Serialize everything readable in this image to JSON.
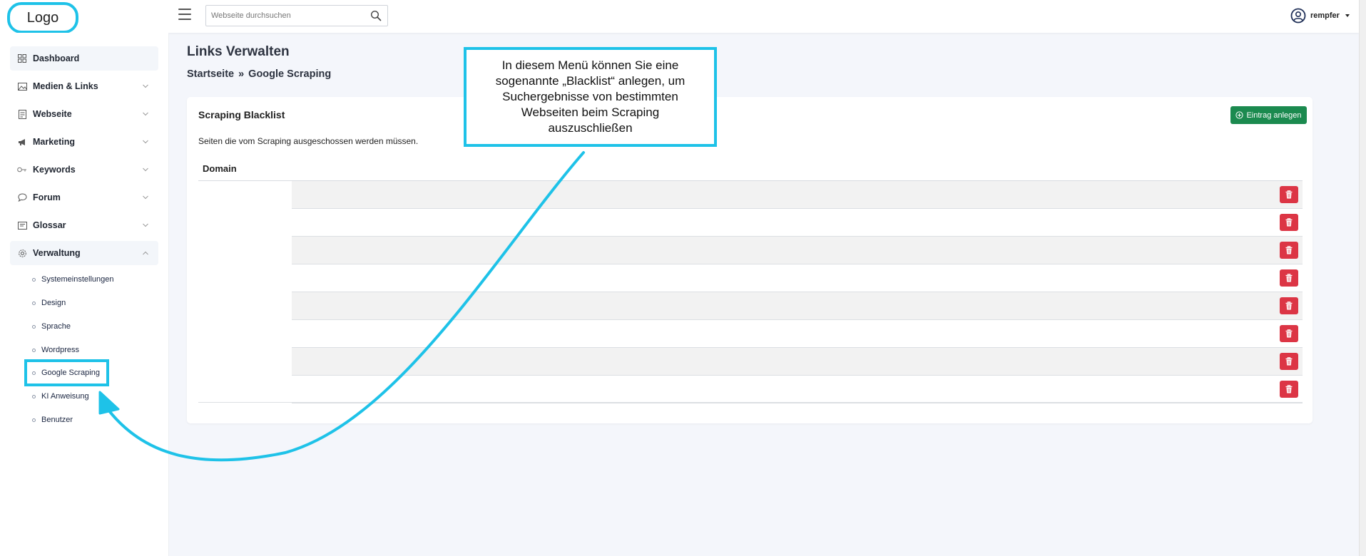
{
  "header": {
    "logo": "Logo",
    "search_placeholder": "Webseite durchsuchen",
    "username": "rempfer"
  },
  "sidebar": {
    "items": [
      {
        "label": "Dashboard",
        "icon": "grid-icon"
      },
      {
        "label": "Medien & Links",
        "icon": "image-icon"
      },
      {
        "label": "Webseite",
        "icon": "document-icon"
      },
      {
        "label": "Marketing",
        "icon": "megaphone-icon"
      },
      {
        "label": "Keywords",
        "icon": "key-icon"
      },
      {
        "label": "Forum",
        "icon": "chat-icon"
      },
      {
        "label": "Glossar",
        "icon": "book-icon"
      },
      {
        "label": "Verwaltung",
        "icon": "gear-icon"
      }
    ],
    "subitems": [
      "Systemeinstellungen",
      "Design",
      "Sprache",
      "Wordpress",
      "Google Scraping",
      "KI Anweisung",
      "Benutzer"
    ]
  },
  "page": {
    "title": "Links Verwalten",
    "breadcrumb": [
      "Startseite",
      "»",
      "Google Scraping"
    ]
  },
  "card": {
    "title": "Scraping Blacklist",
    "add_button": "Eintrag anlegen",
    "description": "Seiten die vom Scraping ausgeschossen werden müssen.",
    "column_header": "Domain",
    "rows": [
      "",
      "",
      "",
      "",
      "",
      "",
      "",
      ""
    ]
  },
  "callout": {
    "text": "In diesem Menü können Sie eine sogenannte „Blacklist“ anlegen, um Suchergebnisse von bestimmten Webseiten beim Scraping auszuschließen"
  },
  "colors": {
    "accent": "#1ec2e8",
    "success": "#1b8a4f",
    "danger": "#dc3545"
  }
}
